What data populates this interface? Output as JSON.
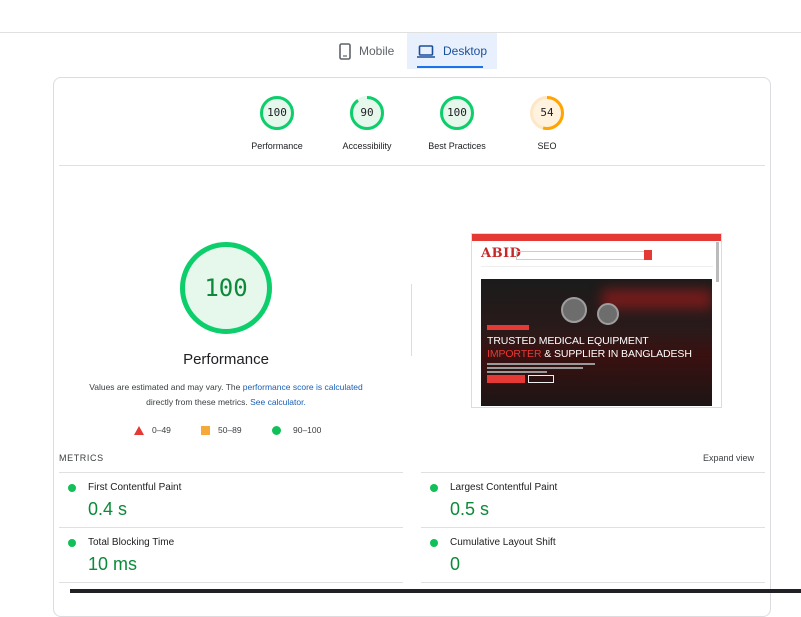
{
  "tabs": [
    {
      "label": "Mobile",
      "icon": "phone-icon",
      "selected": false
    },
    {
      "label": "Desktop",
      "icon": "laptop-icon",
      "selected": true
    }
  ],
  "summary_gauges": [
    {
      "score": "100",
      "label": "Performance",
      "fraction": 1.0,
      "color": "#0cce6b"
    },
    {
      "score": "90",
      "label": "Accessibility",
      "fraction": 0.9,
      "color": "#0cce6b"
    },
    {
      "score": "100",
      "label": "Best Practices",
      "fraction": 1.0,
      "color": "#0cce6b"
    },
    {
      "score": "54",
      "label": "SEO",
      "fraction": 0.54,
      "color": "#ffa400"
    }
  ],
  "performance": {
    "score": "100",
    "fraction": 1.0,
    "title": "Performance",
    "desc_prefix": "Values are estimated and may vary. The",
    "desc_link": "performance score is calculated",
    "desc_mid": "directly from these metrics.",
    "desc_link2": "See calculator."
  },
  "legend": [
    {
      "shape": "triangle",
      "range": "0–49",
      "color": "#e53935"
    },
    {
      "shape": "square",
      "range": "50–89",
      "color": "#f4a939"
    },
    {
      "shape": "circle",
      "range": "90–100",
      "color": "#12c05a"
    }
  ],
  "screenshot": {
    "logo": "ABID",
    "headline_1": "TRUSTED MEDICAL EQUIPMENT",
    "headline_2_red": "IMPORTER",
    "headline_2_rest": " & SUPPLIER IN BANGLADESH"
  },
  "metrics": {
    "heading": "METRICS",
    "expand_label": "Expand view",
    "items": [
      {
        "name": "First Contentful Paint",
        "value": "0.4 s"
      },
      {
        "name": "Largest Contentful Paint",
        "value": "0.5 s"
      },
      {
        "name": "Total Blocking Time",
        "value": "10 ms"
      },
      {
        "name": "Cumulative Layout Shift",
        "value": "0"
      }
    ]
  },
  "colors": {
    "pass": "#0cce6b",
    "average": "#ffa400",
    "fail": "#e53935",
    "tab_accent": "#1a73e8"
  }
}
